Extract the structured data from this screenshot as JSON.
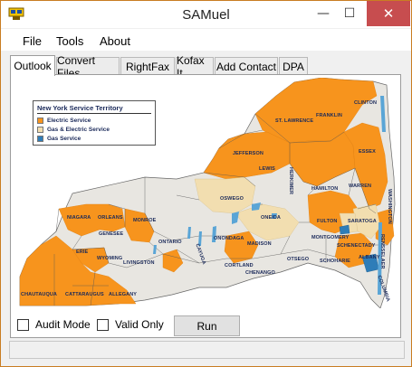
{
  "window": {
    "title": "SAMuel",
    "controls": {
      "minimize": "—",
      "maximize": "☐",
      "close": "✕"
    }
  },
  "menu": {
    "items": [
      "File",
      "Tools",
      "About"
    ]
  },
  "tabs": [
    "Outlook",
    "Convert Files",
    "RightFax",
    "Kofax It",
    "Add Contact",
    "DPA"
  ],
  "active_tab": "Outlook",
  "map": {
    "legend": {
      "title": "New York Service Territory",
      "entries": [
        {
          "label": "Electric Service",
          "color": "#f7941d"
        },
        {
          "label": "Gas & Electric Service",
          "color": "#f2deb0"
        },
        {
          "label": "Gas Service",
          "color": "#2e7db8"
        }
      ]
    },
    "counties": [
      "CLINTON",
      "FRANKLIN",
      "ST. LAWRENCE",
      "ESSEX",
      "JEFFERSON",
      "LEWIS",
      "HERKIMER",
      "HAMILTON",
      "WARREN",
      "WASHINGTON",
      "OSWEGO",
      "ONEIDA",
      "FULTON",
      "SARATOGA",
      "NIAGARA",
      "ORLEANS",
      "MONROE",
      "GENESEE",
      "ONTARIO",
      "ONONDAGA",
      "MADISON",
      "MONTGOMERY",
      "SCHENECTADY",
      "RENSSELAER",
      "ERIE",
      "WYOMING",
      "LIVINGSTON",
      "CAYUGA",
      "CORTLAND",
      "OTSEGO",
      "SCHOHARIE",
      "ALBANY",
      "CHENANGO",
      "COLUMBIA",
      "CHAUTAUQUA",
      "CATTARAUGUS",
      "ALLEGANY"
    ]
  },
  "options": {
    "audit_mode": "Audit Mode",
    "valid_only": "Valid Only"
  },
  "run_button": "Run",
  "colors": {
    "window_border": "#c97d22",
    "close_button": "#c74d4f",
    "electric": "#f7941d",
    "gas_electric": "#f2deb0",
    "gas": "#2e7db8",
    "no_service": "#e8e6e1",
    "water": "#5aa5d6"
  }
}
